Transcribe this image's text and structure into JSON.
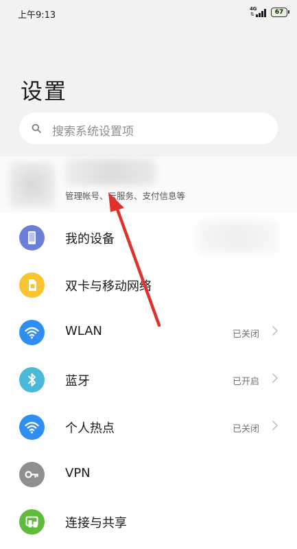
{
  "status_bar": {
    "time": "上午9:13",
    "network": "4G",
    "battery": "67"
  },
  "page_title": "设置",
  "search": {
    "placeholder": "搜索系统设置项"
  },
  "account": {
    "subtitle": "管理帐号、云服务、支付信息等"
  },
  "items": [
    {
      "label": "我的设备",
      "status": "",
      "icon": "phone-device-icon",
      "color": "#6c7fd6"
    },
    {
      "label": "双卡与移动网络",
      "status": "",
      "icon": "sim-card-icon",
      "color": "#f8c531"
    },
    {
      "label": "WLAN",
      "status": "已关闭",
      "icon": "wifi-icon",
      "color": "#2f8ff0"
    },
    {
      "label": "蓝牙",
      "status": "已开启",
      "icon": "bluetooth-icon",
      "color": "#4ab8d8"
    },
    {
      "label": "个人热点",
      "status": "已关闭",
      "icon": "hotspot-icon",
      "color": "#2f8ff0"
    },
    {
      "label": "VPN",
      "status": "",
      "icon": "vpn-key-icon",
      "color": "#8f8f8f"
    },
    {
      "label": "连接与共享",
      "status": "",
      "icon": "connection-share-icon",
      "color": "#5fbb3a"
    }
  ],
  "annotation_color": "#e0322d"
}
